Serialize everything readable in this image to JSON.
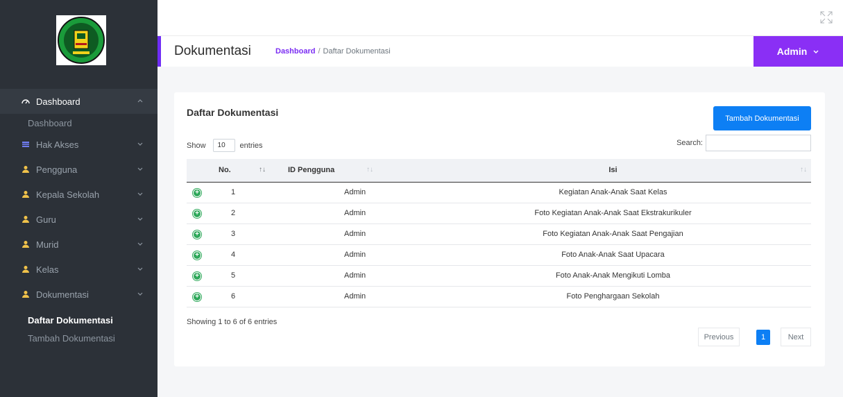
{
  "sidebar": {
    "items": [
      {
        "label": "Dashboard",
        "icon": "dashboard-icon",
        "active": true,
        "chevron": "up"
      },
      {
        "label": "Hak Akses",
        "icon": "table-icon",
        "chevron": "down"
      },
      {
        "label": "Pengguna",
        "icon": "user-icon",
        "chevron": "down"
      },
      {
        "label": "Kepala Sekolah",
        "icon": "user-icon",
        "chevron": "down"
      },
      {
        "label": "Guru",
        "icon": "user-icon",
        "chevron": "down"
      },
      {
        "label": "Murid",
        "icon": "user-icon",
        "chevron": "down"
      },
      {
        "label": "Kelas",
        "icon": "user-icon",
        "chevron": "down"
      },
      {
        "label": "Dokumentasi",
        "icon": "user-icon",
        "chevron": "down"
      }
    ],
    "dashboard_sub": "Dashboard",
    "dokumentasi_sub": [
      "Daftar Dokumentasi",
      "Tambah Dokumentasi"
    ]
  },
  "header": {
    "title": "Dokumentasi",
    "breadcrumb_link": "Dashboard",
    "breadcrumb_sep": "/",
    "breadcrumb_current": "Daftar Dokumentasi",
    "user_menu": "Admin"
  },
  "card": {
    "title": "Daftar Dokumentasi",
    "add_button": "Tambah Dokumentasi",
    "show_label": "Show",
    "entries_value": "10",
    "entries_label": "entries",
    "search_label": "Search:",
    "search_value": "",
    "columns": [
      "No.",
      "ID Pengguna",
      "Isi"
    ],
    "rows": [
      {
        "no": "1",
        "id": "Admin",
        "isi": "Kegiatan Anak-Anak Saat Kelas"
      },
      {
        "no": "2",
        "id": "Admin",
        "isi": "Foto Kegiatan Anak-Anak Saat Ekstrakurikuler"
      },
      {
        "no": "3",
        "id": "Admin",
        "isi": "Foto Kegiatan Anak-Anak Saat Pengajian"
      },
      {
        "no": "4",
        "id": "Admin",
        "isi": "Foto Anak-Anak Saat Upacara"
      },
      {
        "no": "5",
        "id": "Admin",
        "isi": "Foto Anak-Anak Mengikuti Lomba"
      },
      {
        "no": "6",
        "id": "Admin",
        "isi": "Foto Penghargaan Sekolah"
      }
    ],
    "info": "Showing 1 to 6 of 6 entries",
    "pagination": {
      "previous": "Previous",
      "page": "1",
      "next": "Next"
    }
  },
  "colors": {
    "sidebar_bg": "#2c3138",
    "accent_purple": "#8a2ff5",
    "primary_blue": "#0d7ff4",
    "row_plus_green": "#2ea85a"
  }
}
